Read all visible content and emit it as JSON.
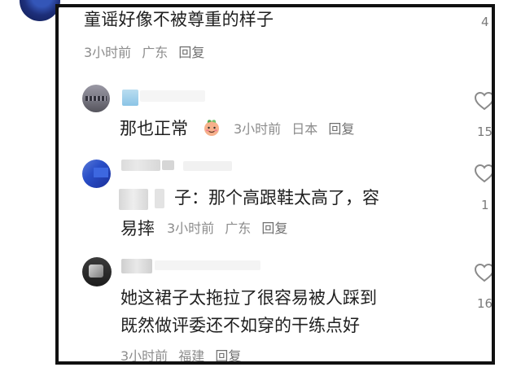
{
  "comments": [
    {
      "text": "童谣好像不被尊重的样子",
      "time": "3小时前",
      "location": "广东",
      "reply_label": "回复",
      "like_count": "4"
    },
    {
      "text": "那也正常",
      "time": "3小时前",
      "location": "日本",
      "reply_label": "回复",
      "like_count": "15",
      "emoji": "peach-face-emoji"
    },
    {
      "text_line_1": "子：那个高跟鞋太高了，容",
      "text_line_2": "易摔",
      "time": "3小时前",
      "location": "广东",
      "reply_label": "回复",
      "like_count": "1"
    },
    {
      "text_line_1": "她这裙子太拖拉了很容易被人踩到",
      "text_line_2": "既然做评委还不如穿的干练点好",
      "time": "3小时前",
      "location": "福建",
      "reply_label": "回复",
      "like_count": "16"
    }
  ],
  "icons": {
    "heart": "heart-outline-icon",
    "emoji": "peach-face-emoji"
  },
  "colors": {
    "frame": "#111111",
    "text": "#1f1f1f",
    "meta": "#8c8c8c",
    "heart_stroke": "#8a8a8a"
  }
}
